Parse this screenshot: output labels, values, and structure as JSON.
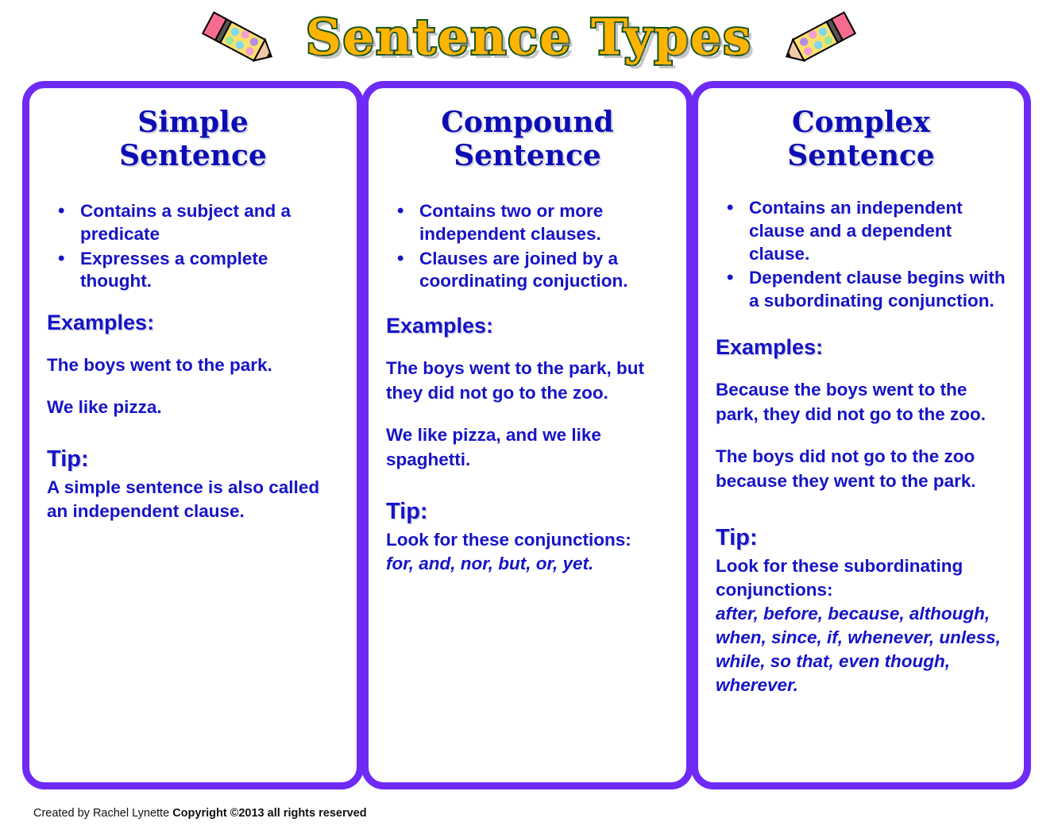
{
  "header": {
    "title": "Sentence Types",
    "left_icon": "pencil-icon",
    "right_icon": "pencil-icon",
    "title_fill_color": "#FFB400",
    "title_outline_color": "#14531C"
  },
  "theme": {
    "card_border_color": "#6E2BF5",
    "text_color": "#1614C6",
    "heading_color": "#0D0DB5"
  },
  "columns": [
    {
      "title_line1": "Simple",
      "title_line2": "Sentence",
      "bullets": [
        "Contains a subject and a predicate",
        "Expresses a complete thought."
      ],
      "examples_label": "Examples:",
      "examples": [
        "The boys went to the park.",
        "We like pizza."
      ],
      "tip_label": "Tip:",
      "tip_body": "A simple sentence is also called an independent clause.",
      "tip_list": ""
    },
    {
      "title_line1": "Compound",
      "title_line2": "Sentence",
      "bullets": [
        "Contains two or more independent clauses.",
        "Clauses are joined by a coordinating conjuction."
      ],
      "examples_label": "Examples:",
      "examples": [
        "The boys went to the park, but they did not go to the zoo.",
        " We like pizza, and we like spaghetti."
      ],
      "tip_label": "Tip:",
      "tip_body": "Look for these conjunctions:",
      "tip_list": "for, and, nor, but, or, yet."
    },
    {
      "title_line1": "Complex",
      "title_line2": "Sentence",
      "bullets": [
        "Contains an independent clause and a dependent clause.",
        "Dependent clause begins with a subordinating conjunction."
      ],
      "examples_label": "Examples:",
      "examples": [
        "Because the boys went to the park, they did not go to the zoo.",
        "The boys did not go to the zoo because they went to the park."
      ],
      "tip_label": "Tip:",
      "tip_body": "Look for these subordinating conjunctions:",
      "tip_list": "after, before, because, although, when, since, if, whenever, unless, while, so that, even though, wherever."
    }
  ],
  "footer": {
    "created_by": "Created by Rachel Lynette ",
    "copyright": "Copyright ©2013   all rights reserved"
  }
}
